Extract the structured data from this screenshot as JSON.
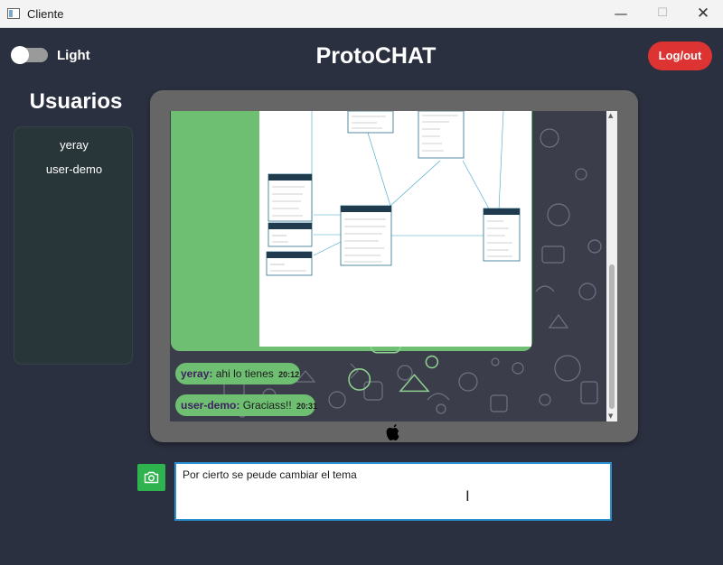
{
  "window": {
    "title": "Cliente",
    "controls": {
      "minimize": "—",
      "maximize": "☐",
      "close": "✕"
    }
  },
  "theme_toggle": {
    "label": "Light",
    "on": false
  },
  "header": {
    "title": "ProtoCHAT",
    "logout_label": "Log/out"
  },
  "sidebar": {
    "title": "Usuarios",
    "users": [
      "yeray",
      "user-demo"
    ]
  },
  "chat": {
    "messages": [
      {
        "user": "yeray:",
        "text": "ahi lo tienes",
        "time": "20:12"
      },
      {
        "user": "user-demo:",
        "text": "Graciass!!",
        "time": "20:31"
      }
    ]
  },
  "composer": {
    "value": "Por cierto se peude cambiar el tema",
    "camera_icon": "camera-icon"
  },
  "colors": {
    "background": "#2b3040",
    "accent_green": "#6fbf73",
    "logout_red": "#dd3332",
    "camera_green": "#2eb34f",
    "input_border": "#2a8fd0"
  }
}
